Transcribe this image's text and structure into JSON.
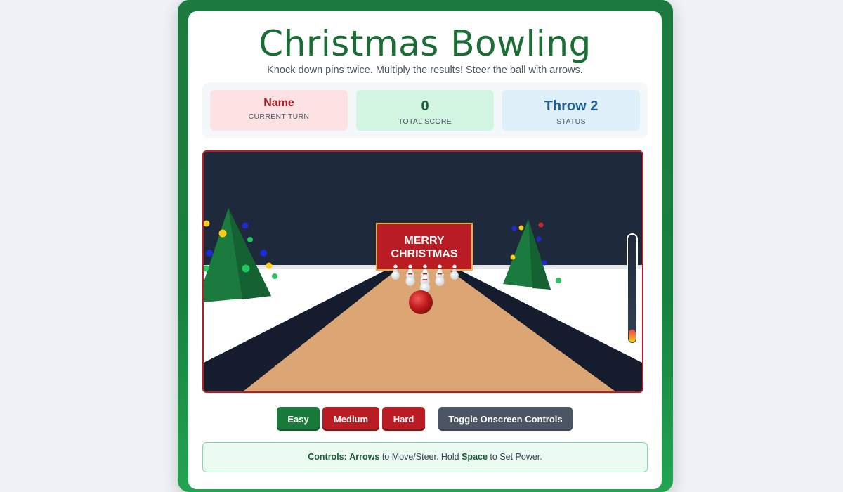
{
  "app": {
    "title": "Christmas Bowling",
    "subtitle": "Knock down pins twice. Multiply the results! Steer the ball with arrows."
  },
  "stats": {
    "current_turn": {
      "value": "Name",
      "label": "CURRENT TURN"
    },
    "total_score": {
      "value": "0",
      "label": "TOTAL SCORE"
    },
    "status": {
      "value": "Throw 2",
      "label": "STATUS"
    }
  },
  "scene": {
    "banner_line1": "MERRY",
    "banner_line2": "CHRISTMAS",
    "pins_standing": 10,
    "power_level": 0.12,
    "colors": {
      "sky": "#1e293b",
      "snow": "#ffffff",
      "lane": "#dba674",
      "gutter": "#141c2e",
      "banner": "#b91c22",
      "banner_border": "#e8b13a",
      "tree": "#1b7a3e",
      "ball": "#c21c1c"
    }
  },
  "difficulty": {
    "easy": "Easy",
    "medium": "Medium",
    "hard": "Hard",
    "selected": "Easy"
  },
  "toggle_controls_label": "Toggle Onscreen Controls",
  "controls_hint": {
    "prefix": "Controls:",
    "key1": "Arrows",
    "text1": " to Move/Steer. Hold ",
    "key2": "Space",
    "text2": " to Set Power."
  }
}
